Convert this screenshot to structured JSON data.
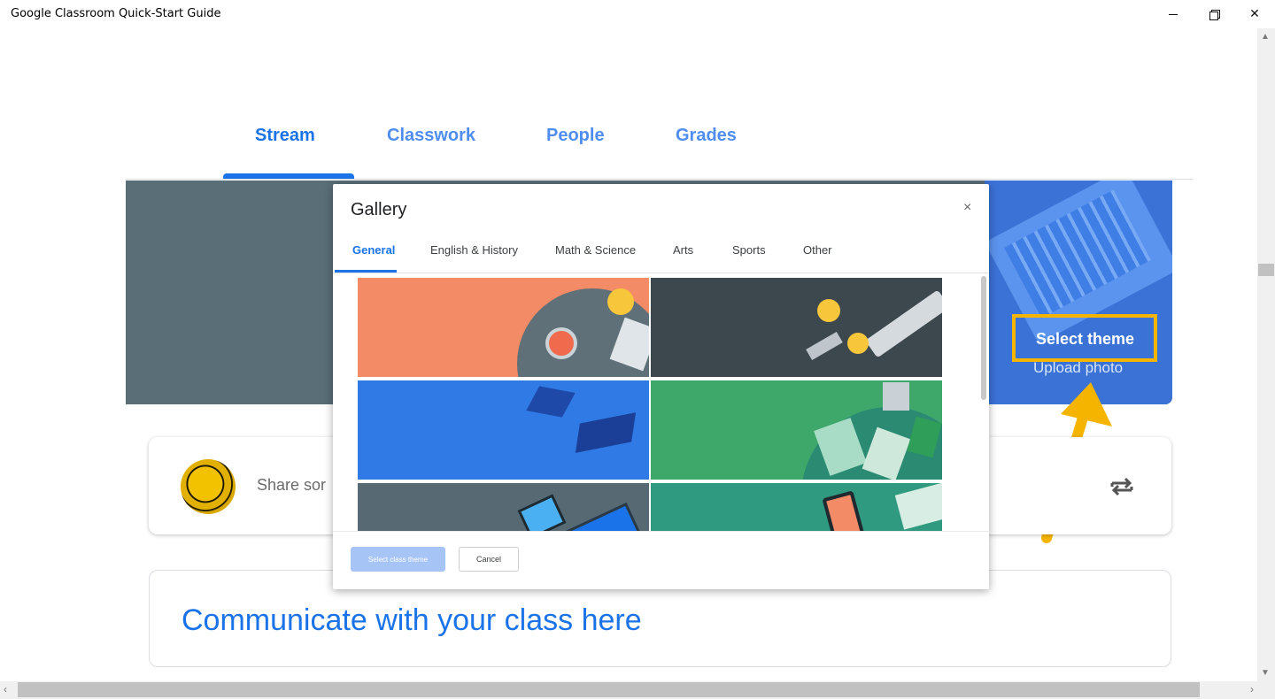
{
  "window": {
    "title": "Google Classroom Quick-Start Guide",
    "minimize": "—",
    "close": "✕"
  },
  "classroom": {
    "tabs": [
      {
        "label": "Stream",
        "active": true
      },
      {
        "label": "Classwork",
        "active": false
      },
      {
        "label": "People",
        "active": false
      },
      {
        "label": "Grades",
        "active": false
      }
    ],
    "banner": {
      "select_theme": "Select theme",
      "upload_photo": "Upload photo"
    },
    "post_bar": {
      "placeholder": "Share sor"
    },
    "communicate": {
      "heading": "Communicate with your class here"
    }
  },
  "gallery": {
    "title": "Gallery",
    "close_icon": "×",
    "tabs": [
      "General",
      "English & History",
      "Math & Science",
      "Arts",
      "Sports",
      "Other"
    ],
    "active_tab": "General",
    "select_button": "Select class theme",
    "cancel_button": "Cancel",
    "themes": [
      {
        "name": "coffee-desk",
        "color": "#f28b66"
      },
      {
        "name": "graduation-scroll",
        "color": "#3c474e"
      },
      {
        "name": "graduation-caps",
        "color": "#2f7ae5"
      },
      {
        "name": "notebook-desk",
        "color": "#3ea86b"
      },
      {
        "name": "tablet-laptop",
        "color": "#576a74"
      },
      {
        "name": "phone-notes",
        "color": "#2f9a80"
      }
    ]
  },
  "colors": {
    "accent": "#1a73e8",
    "highlight": "#f4b400"
  }
}
